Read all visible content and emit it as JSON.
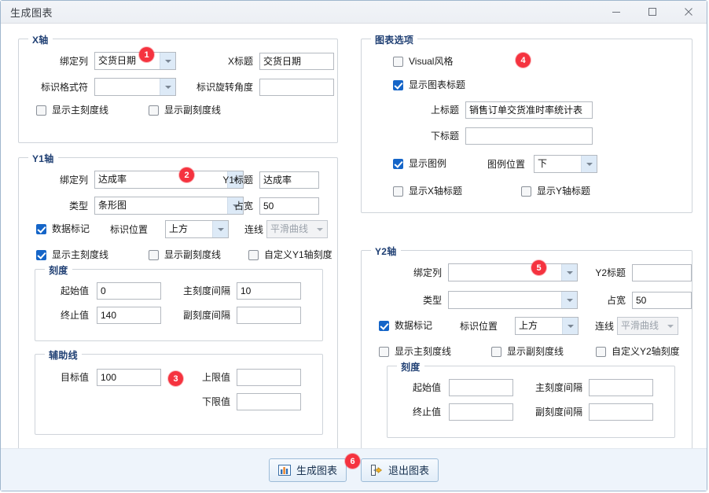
{
  "window": {
    "title": "生成图表",
    "controls": {
      "minimize": "—",
      "maximize": "▢",
      "close": "✕"
    }
  },
  "x_axis": {
    "group_label": "X轴",
    "bind_column_label": "绑定列",
    "bind_column_value": "交货日期",
    "x_title_label": "X标题",
    "x_title_value": "交货日期",
    "format_label": "标识格式符",
    "format_value": "",
    "rotate_label": "标识旋转角度",
    "rotate_value": "",
    "show_major_ticks": "显示主刻度线",
    "show_minor_ticks": "显示副刻度线",
    "badge": "1"
  },
  "y1_axis": {
    "group_label": "Y1轴",
    "bind_column_label": "绑定列",
    "bind_column_value": "达成率",
    "y1_title_label": "Y1标题",
    "y1_title_value": "达成率",
    "type_label": "类型",
    "type_value": "条形图",
    "width_label": "占宽",
    "width_value": "50",
    "data_marker_label": "数据标记",
    "marker_pos_label": "标识位置",
    "marker_pos_value": "上方",
    "line_label": "连线",
    "line_value": "平滑曲线",
    "show_major_ticks": "显示主刻度线",
    "show_minor_ticks": "显示副刻度线",
    "custom_scale": "自定义Y1轴刻度",
    "badge": "2",
    "scale": {
      "group_label": "刻度",
      "start_label": "起始值",
      "start_value": "0",
      "end_label": "终止值",
      "end_value": "140",
      "major_interval_label": "主刻度间隔",
      "major_interval_value": "10",
      "minor_interval_label": "副刻度间隔",
      "minor_interval_value": ""
    },
    "aux_line": {
      "group_label": "辅助线",
      "target_label": "目标值",
      "target_value": "100",
      "upper_label": "上限值",
      "upper_value": "",
      "lower_label": "下限值",
      "lower_value": "",
      "badge": "3"
    }
  },
  "chart_options": {
    "group_label": "图表选项",
    "visual_style": "Visual风格",
    "show_chart_title": "显示图表标题",
    "top_title_label": "上标题",
    "top_title_value": "销售订单交货准时率统计表",
    "bottom_title_label": "下标题",
    "bottom_title_value": "",
    "show_legend": "显示图例",
    "legend_pos_label": "图例位置",
    "legend_pos_value": "下",
    "show_x_title": "显示X轴标题",
    "show_y_title": "显示Y轴标题",
    "badge": "4"
  },
  "y2_axis": {
    "group_label": "Y2轴",
    "bind_column_label": "绑定列",
    "bind_column_value": "",
    "y2_title_label": "Y2标题",
    "y2_title_value": "",
    "type_label": "类型",
    "type_value": "",
    "width_label": "占宽",
    "width_value": "50",
    "data_marker_label": "数据标记",
    "marker_pos_label": "标识位置",
    "marker_pos_value": "上方",
    "line_label": "连线",
    "line_value": "平滑曲线",
    "show_major_ticks": "显示主刻度线",
    "show_minor_ticks": "显示副刻度线",
    "custom_scale": "自定义Y2轴刻度",
    "badge": "5",
    "scale": {
      "group_label": "刻度",
      "start_label": "起始值",
      "start_value": "",
      "end_label": "终止值",
      "end_value": "",
      "major_interval_label": "主刻度间隔",
      "major_interval_value": "",
      "minor_interval_label": "副刻度间隔",
      "minor_interval_value": ""
    }
  },
  "footer": {
    "generate_label": "生成图表",
    "exit_label": "退出图表",
    "badge": "6"
  },
  "colors": {
    "accent": "#1565c8",
    "group_label": "#1f3f73",
    "badge": "#f5333f",
    "footer_bg": "#eef4fb",
    "combo_button": "#ddeaf7"
  }
}
